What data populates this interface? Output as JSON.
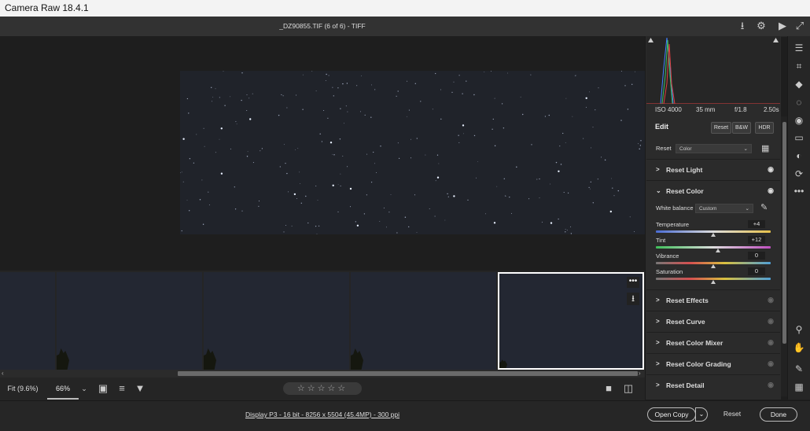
{
  "window": {
    "title": "Camera Raw 18.4.1"
  },
  "header": {
    "doc_title": "_DZ90855.TIF (6 of 6)  -  TIFF"
  },
  "zoom": {
    "fit_label": "Fit (9.6%)",
    "current": "66%",
    "dropdown": "⌄"
  },
  "rating": {
    "stars": "☆☆☆☆☆"
  },
  "status": {
    "info": "Display P3 - 16 bit - 8256 x 5504 (45.4MP) - 300 ppi"
  },
  "footer": {
    "open_copy": "Open Copy",
    "open_copy_dd": "⌄",
    "reset": "Reset",
    "done": "Done"
  },
  "exif": {
    "iso": "ISO 4000",
    "focal": "35 mm",
    "aperture": "f/1.8",
    "shutter": "2.50s"
  },
  "edit": {
    "title": "Edit",
    "buttons": {
      "reset": "Reset",
      "bw": "B&W",
      "hdr": "HDR"
    },
    "profile_label": "Reset",
    "profile_value": "Color"
  },
  "sections": {
    "light": "Reset Light",
    "color": "Reset Color",
    "effects": "Reset Effects",
    "curve": "Reset Curve",
    "color_mixer": "Reset Color Mixer",
    "color_grading": "Reset Color Grading",
    "detail": "Reset Detail"
  },
  "color_panel": {
    "white_balance_label": "White balance",
    "white_balance_value": "Custom",
    "sliders": [
      {
        "label": "Temperature",
        "value": "+4",
        "position": 0.5
      },
      {
        "label": "Tint",
        "value": "+12",
        "position": 0.54
      },
      {
        "label": "Vibrance",
        "value": "0",
        "position": 0.5
      },
      {
        "label": "Saturation",
        "value": "0",
        "position": 0.5
      }
    ]
  },
  "colors": {
    "accent": "#ffffff",
    "panel_bg": "#2b2b2b",
    "canvas_bg": "#1e1e1e",
    "hist_red": "#e04040",
    "hist_green": "#40c060",
    "hist_blue": "#4080ff"
  }
}
